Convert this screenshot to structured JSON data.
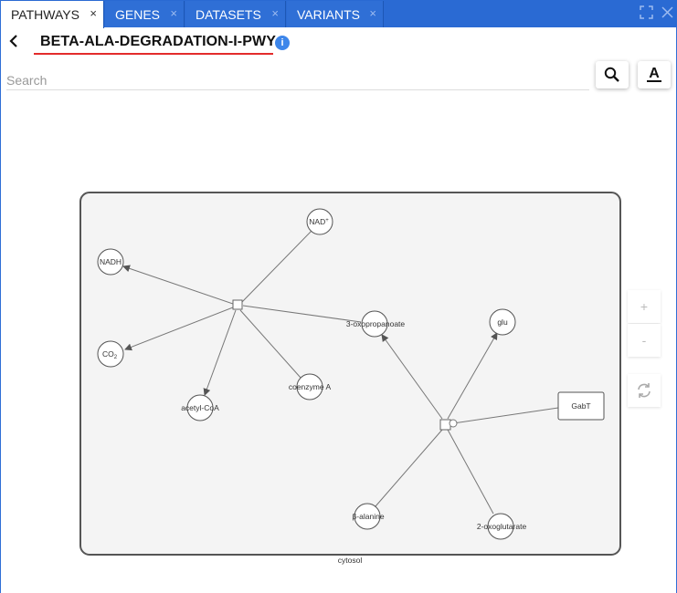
{
  "tabs": [
    {
      "label": "PATHWAYS",
      "close": "×"
    },
    {
      "label": "GENES",
      "close": "×"
    },
    {
      "label": "DATASETS",
      "close": "×"
    },
    {
      "label": "VARIANTS",
      "close": "×"
    }
  ],
  "window": {
    "expand_icon": "expand-icon",
    "close_icon": "close-icon"
  },
  "header": {
    "back_icon": "chevron-left-icon",
    "title": "BETA-ALA-DEGRADATION-I-PWY",
    "info_icon": "info-icon",
    "info_glyph": "i"
  },
  "search": {
    "placeholder": "Search",
    "value": ""
  },
  "toolbar": {
    "search_icon": "search-icon",
    "font_icon": "font-underline-icon",
    "font_glyph": "A"
  },
  "zoom": {
    "in": "+",
    "out": "-",
    "reset_icon": "refresh-icon"
  },
  "graph": {
    "compartment": "cytosol",
    "nodes": {
      "nad": "NAD",
      "nad_sup": "+",
      "nadh": "NADH",
      "co2": "CO",
      "co2_sub": "2",
      "acetylcoa": "acetyl-CoA",
      "coenzymea": "coenzyme A",
      "oxopropanoate": "3-oxopropanoate",
      "glu": "glu",
      "gabt": "GabT",
      "alanine": "β-alanine",
      "oxoglutarate": "2-oxoglutarate"
    }
  },
  "colors": {
    "tab_blue": "#2a6ad3",
    "accent_red": "#e32b2b",
    "info_blue": "#3d86ea"
  }
}
